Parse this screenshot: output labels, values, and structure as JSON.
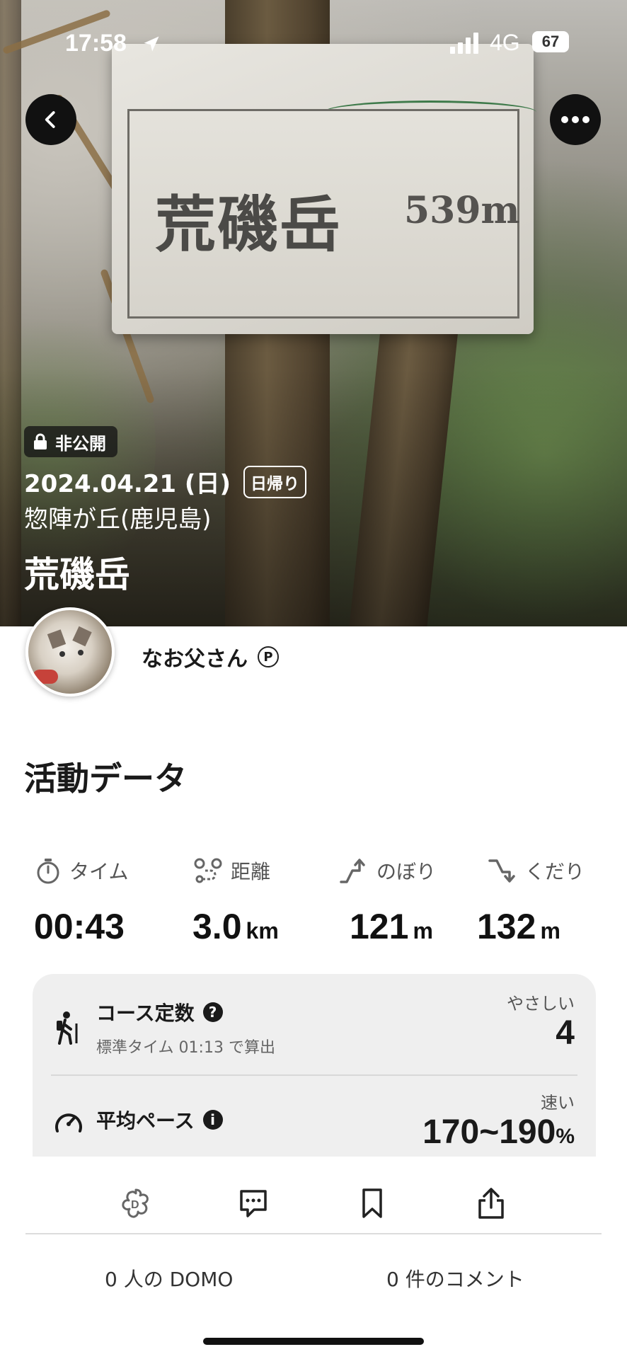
{
  "status_bar": {
    "time": "17:58",
    "network": "4G",
    "battery": "67"
  },
  "hero": {
    "sign_name": "荒磯岳",
    "sign_elevation": "539m",
    "privacy_label": "非公開",
    "date": "2024.04.21 (日)",
    "trip_type": "日帰り",
    "region": "惣陣が丘(鹿児島)",
    "title": "荒磯岳"
  },
  "user": {
    "name": "なお父さん",
    "badge": "P"
  },
  "section_title": "活動データ",
  "stats": [
    {
      "label": "タイム",
      "value": "00:43",
      "unit": "",
      "icon": "stopwatch-icon"
    },
    {
      "label": "距離",
      "value": "3.0",
      "unit": "km",
      "icon": "route-icon"
    },
    {
      "label": "のぼり",
      "value": "121",
      "unit": "m",
      "icon": "ascent-icon"
    },
    {
      "label": "くだり",
      "value": "132",
      "unit": "m",
      "icon": "descent-icon"
    }
  ],
  "course": {
    "title": "コース定数",
    "subtitle": "標準タイム 01:13 で算出",
    "level_label": "やさしい",
    "value": "4"
  },
  "pace": {
    "title": "平均ペース",
    "speed_label": "速い",
    "value": "170~190",
    "unit": "%"
  },
  "actions": {
    "domo_count": "0 人の DOMO",
    "comment_count": "0 件のコメント"
  },
  "colors": {
    "accent": "#1a1a1a",
    "card_bg": "#efefef"
  }
}
